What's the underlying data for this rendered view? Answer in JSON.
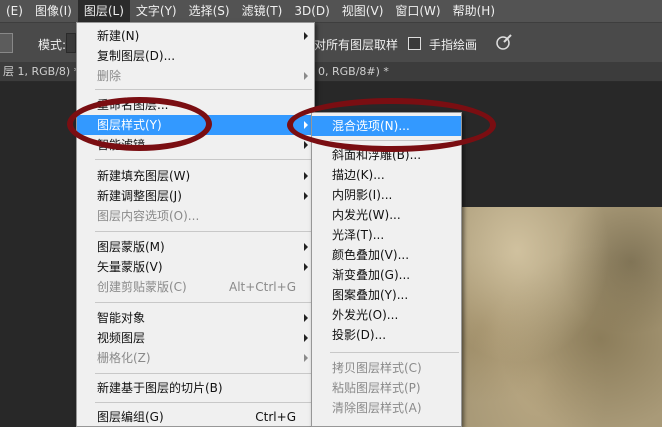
{
  "menubar": [
    {
      "label": "(E)",
      "active": false
    },
    {
      "label": "图像(I)",
      "active": false
    },
    {
      "label": "图层(L)",
      "active": true
    },
    {
      "label": "文字(Y)",
      "active": false
    },
    {
      "label": "选择(S)",
      "active": false
    },
    {
      "label": "滤镜(T)",
      "active": false
    },
    {
      "label": "3D(D)",
      "active": false
    },
    {
      "label": "视图(V)",
      "active": false
    },
    {
      "label": "窗口(W)",
      "active": false
    },
    {
      "label": "帮助(H)",
      "active": false
    }
  ],
  "options": {
    "mode_label": "模式:",
    "sample_all_label": "对所有图层取样",
    "finger_paint_label": "手指绘画"
  },
  "tabs": {
    "tab1": "层 1, RGB/8) *",
    "tab2": "0, RGB/8#) *"
  },
  "layer_menu": {
    "new": "新建(N)",
    "duplicate": "复制图层(D)...",
    "delete": "删除",
    "rename": "重命名图层...",
    "layer_style": "图层样式(Y)",
    "smart_filter": "智能滤镜",
    "new_fill": "新建填充图层(W)",
    "new_adjust": "新建调整图层(J)",
    "content_options": "图层内容选项(O)...",
    "layer_mask": "图层蒙版(M)",
    "vector_mask": "矢量蒙版(V)",
    "clipping_mask": "创建剪贴蒙版(C)",
    "clipping_shortcut": "Alt+Ctrl+G",
    "smart_object": "智能对象",
    "video_layers": "视频图层",
    "rasterize": "栅格化(Z)",
    "new_slice": "新建基于图层的切片(B)",
    "group": "图层编组(G)",
    "group_shortcut": "Ctrl+G"
  },
  "style_menu": {
    "blending": "混合选项(N)...",
    "bevel": "斜面和浮雕(B)...",
    "stroke": "描边(K)...",
    "inner_shadow": "内阴影(I)...",
    "inner_glow": "内发光(W)...",
    "satin": "光泽(T)...",
    "color_overlay": "颜色叠加(V)...",
    "gradient_overlay": "渐变叠加(G)...",
    "pattern_overlay": "图案叠加(Y)...",
    "outer_glow": "外发光(O)...",
    "drop_shadow": "投影(D)...",
    "copy_style": "拷贝图层样式(C)",
    "paste_style": "粘贴图层样式(P)",
    "clear_style": "清除图层样式(A)"
  },
  "colors": {
    "highlight": "#3399ff",
    "annotation": "#7a0e12"
  }
}
